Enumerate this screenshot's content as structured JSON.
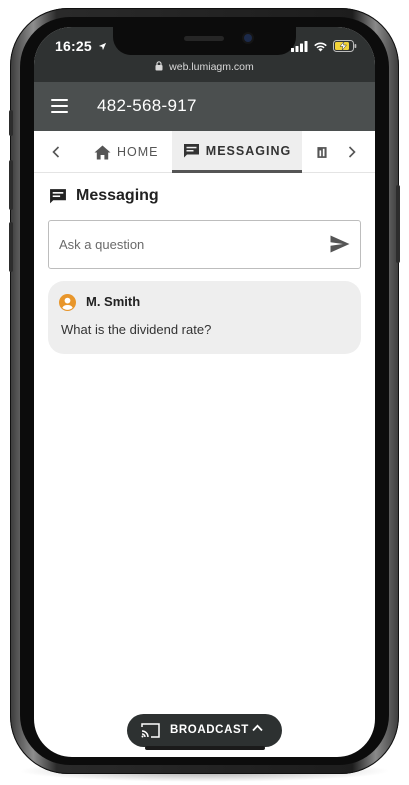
{
  "status_bar": {
    "time": "16:25",
    "icons": [
      "location-arrow-icon",
      "signal-icon",
      "wifi-icon",
      "battery-charging-icon"
    ]
  },
  "browser": {
    "url": "web.lumiagm.com"
  },
  "app_header": {
    "meeting_id": "482-568-917"
  },
  "tabs": {
    "items": [
      {
        "label": "HOME",
        "icon": "home-icon",
        "active": false
      },
      {
        "label": "MESSAGING",
        "icon": "chat-icon",
        "active": true
      }
    ]
  },
  "messaging": {
    "title": "Messaging",
    "input_placeholder": "Ask a question",
    "messages": [
      {
        "author": "M. Smith",
        "text": "What is the dividend rate?"
      }
    ]
  },
  "broadcast": {
    "label": "BROADCAST"
  },
  "colors": {
    "header_bg": "#4b4f4f",
    "browser_bar_bg": "#2f3232",
    "avatar_accent": "#e8962b",
    "message_bubble_bg": "#eeeeee",
    "broadcast_pill_bg": "#2d3131"
  }
}
